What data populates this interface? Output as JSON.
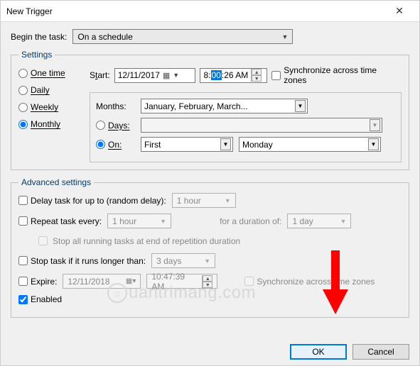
{
  "window": {
    "title": "New Trigger"
  },
  "begin": {
    "label": "Begin the task:",
    "value": "On a schedule"
  },
  "settings": {
    "legend": "Settings",
    "radios": {
      "one_time": "One time",
      "daily": "Daily",
      "weekly": "Weekly",
      "monthly": "Monthly"
    },
    "start_label": "Start:",
    "start_date": "12/11/2017",
    "start_time_h": "8:",
    "start_time_sel": "00",
    "start_time_rest": ":26 AM",
    "sync_label": "Synchronize across time zones",
    "months_label": "Months:",
    "months_value": "January, February, March...",
    "days_label": "Days:",
    "days_value": "",
    "on_label": "On:",
    "on_ordinal": "First",
    "on_day": "Monday"
  },
  "advanced": {
    "legend": "Advanced settings",
    "delay_label": "Delay task for up to (random delay):",
    "delay_value": "1 hour",
    "repeat_label": "Repeat task every:",
    "repeat_value": "1 hour",
    "duration_label": "for a duration of:",
    "duration_value": "1 day",
    "stop_all_label": "Stop all running tasks at end of repetition duration",
    "stop_if_label": "Stop task if it runs longer than:",
    "stop_if_value": "3 days",
    "expire_label": "Expire:",
    "expire_date": "12/11/2018",
    "expire_time": "10:47:39 AM",
    "sync_label": "Synchronize across time zones",
    "enabled_label": "Enabled"
  },
  "buttons": {
    "ok": "OK",
    "cancel": "Cancel"
  },
  "watermark": "uantrimang"
}
